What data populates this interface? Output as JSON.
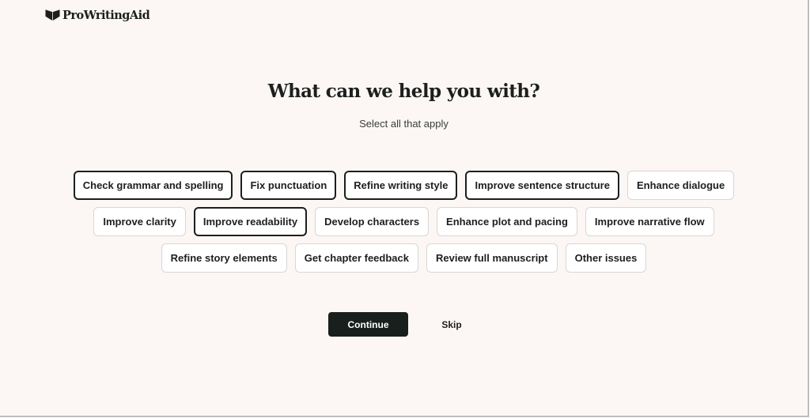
{
  "header": {
    "logo_text": "ProWritingAid",
    "logo_icon": "book-heart-icon"
  },
  "main": {
    "title": "What can we help you with?",
    "subtitle": "Select all that apply",
    "options": [
      {
        "label": "Check grammar and spelling",
        "selected": true
      },
      {
        "label": "Fix punctuation",
        "selected": true
      },
      {
        "label": "Refine writing style",
        "selected": true
      },
      {
        "label": "Improve sentence structure",
        "selected": true
      },
      {
        "label": "Enhance dialogue",
        "selected": false
      },
      {
        "label": "Improve clarity",
        "selected": false
      },
      {
        "label": "Improve readability",
        "selected": true
      },
      {
        "label": "Develop characters",
        "selected": false
      },
      {
        "label": "Enhance plot and pacing",
        "selected": false
      },
      {
        "label": "Improve narrative flow",
        "selected": false
      },
      {
        "label": "Refine story elements",
        "selected": false
      },
      {
        "label": "Get chapter feedback",
        "selected": false
      },
      {
        "label": "Review full manuscript",
        "selected": false
      },
      {
        "label": "Other issues",
        "selected": false
      }
    ]
  },
  "actions": {
    "continue_label": "Continue",
    "skip_label": "Skip"
  },
  "colors": {
    "background": "#fcf7f4",
    "primary": "#18201d",
    "chip_border": "#d9d6d3",
    "chip_selected_border": "#1c1f1e"
  }
}
